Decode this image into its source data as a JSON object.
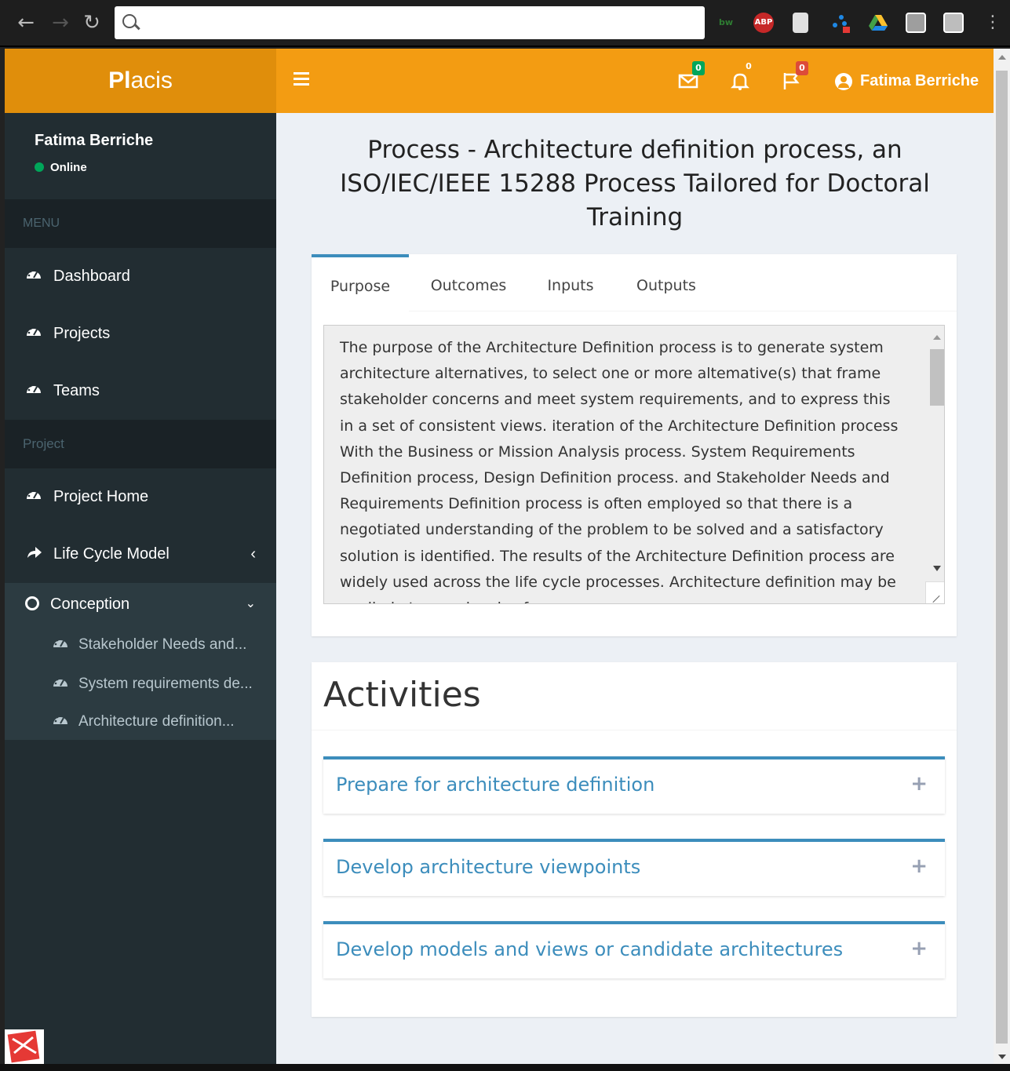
{
  "browser": {
    "address_value": "",
    "extensions": [
      {
        "icon": "bw-icon",
        "label": "bw",
        "color": "#2e7d32"
      },
      {
        "icon": "adblock-icon",
        "label": "ABP",
        "color": "#c62828"
      },
      {
        "icon": "document-icon",
        "label": "",
        "color": "#e0e0e0"
      },
      {
        "icon": "network-icon",
        "label": "",
        "color": "#1565c0"
      },
      {
        "icon": "drive-icon",
        "label": "",
        "color": "#fbc02d"
      },
      {
        "icon": "pin-icon",
        "label": "",
        "color": "#9e9e9e"
      },
      {
        "icon": "photo-icon",
        "label": "",
        "color": "#9e9e9e"
      }
    ]
  },
  "header": {
    "brand_bold": "Pl",
    "brand_rest": "acis",
    "messages_count": "0",
    "notifications_count": "0",
    "flags_count": "0",
    "user_name": "Fatima Berriche",
    "accent_color": "#f39c12"
  },
  "sidebar": {
    "user_name": "Fatima Berriche",
    "user_status": "Online",
    "menu_header": "MENU",
    "main_items": [
      {
        "label": "Dashboard"
      },
      {
        "label": "Projects"
      },
      {
        "label": "Teams"
      }
    ],
    "project_header": "Project",
    "project_items": [
      {
        "label": "Project Home"
      },
      {
        "label": "Life Cycle Model"
      }
    ],
    "conception": {
      "label": "Conception",
      "children": [
        {
          "label": "Stakeholder Needs and..."
        },
        {
          "label": "System requirements de..."
        },
        {
          "label": "Architecture definition..."
        }
      ]
    }
  },
  "main": {
    "title": "Process - Architecture definition process, an ISO/IEC/IEEE 15288 Process Tailored for Doctoral Training",
    "tabs": [
      {
        "label": "Purpose",
        "active": true
      },
      {
        "label": "Outcomes",
        "active": false
      },
      {
        "label": "Inputs",
        "active": false
      },
      {
        "label": "Outputs",
        "active": false
      }
    ],
    "purpose_text": "The purpose of the Architecture Definition process is to generate system architecture alternatives, to select one or more altemative(s) that frame stakeholder concerns and meet system requirements, and to express this in a set of consistent views. iteration of the Architecture Definition process With the Business or Mission Analysis process. System Requirements Definition process, Design Definition process. and Stakeholder Needs and Requirements Definition process is often employed so that there is a negotiated understanding of the problem to be solved and a satisfactory solution is identified. The results of the Architecture Definition process are widely used across the life cycle processes. Architecture definition may be applied at many levels of",
    "activities_title": "Activities",
    "activities": [
      {
        "title": "Prepare for architecture definition"
      },
      {
        "title": "Develop architecture viewpoints"
      },
      {
        "title": "Develop models and views or candidate architectures"
      }
    ]
  }
}
